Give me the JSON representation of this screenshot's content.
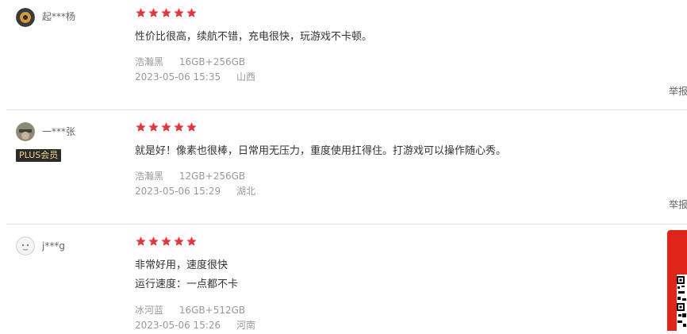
{
  "reviews": [
    {
      "username": "起***杨",
      "badge": "",
      "rating": 5,
      "content_lines": [
        "性价比很高，续航不错，充电很快，玩游戏不卡顿。"
      ],
      "color": "浩瀚黑",
      "spec": "16GB+256GB",
      "date": "2023-05-06 15:35",
      "location": "山西",
      "report_label": "举报"
    },
    {
      "username": "一***张",
      "badge": "PLUS会员",
      "rating": 5,
      "content_lines": [
        "就是好！像素也很棒，日常用无压力，重度使用扛得住。打游戏可以操作随心秀。"
      ],
      "color": "浩瀚黑",
      "spec": "12GB+256GB",
      "date": "2023-05-06 15:29",
      "location": "湖北",
      "report_label": "举报"
    },
    {
      "username": "j***g",
      "badge": "",
      "rating": 5,
      "content_lines": [
        "非常好用，速度很快",
        "运行速度：一点都不卡"
      ],
      "color": "冰河蓝",
      "spec": "16GB+512GB",
      "date": "2023-05-06 15:26",
      "location": "河南",
      "report_label": ""
    }
  ],
  "colors": {
    "star": "#e4393c",
    "side_panel": "#e1251b",
    "badge_bg": "#2b2b2b",
    "badge_text": "#f3d48a"
  }
}
